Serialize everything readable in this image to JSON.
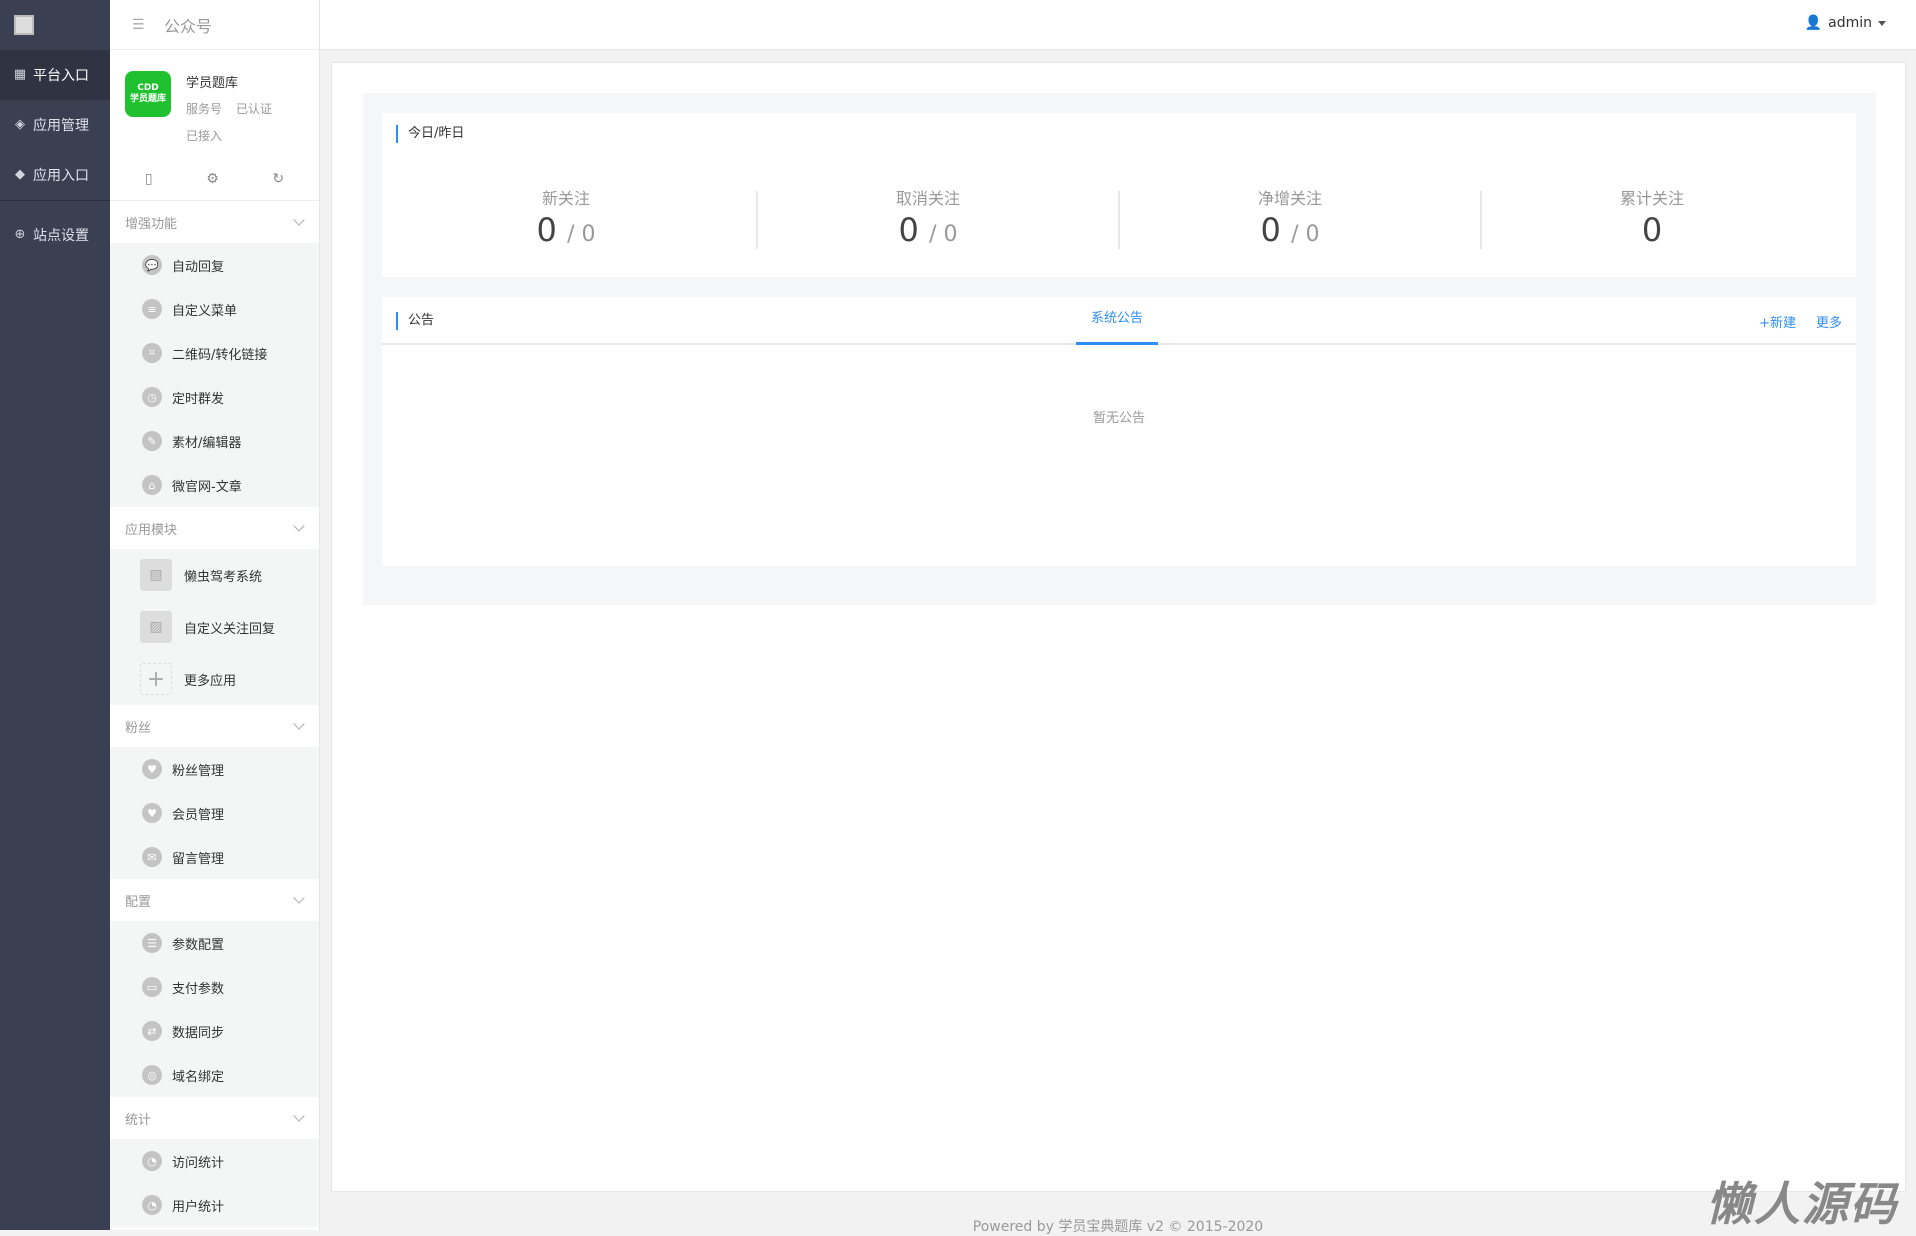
{
  "nav1": {
    "items": [
      {
        "label": "平台入口",
        "icon": "grid-icon",
        "active": true
      },
      {
        "label": "应用管理",
        "icon": "cubes-icon"
      },
      {
        "label": "应用入口",
        "icon": "cube-icon"
      }
    ],
    "settings": {
      "label": "站点设置",
      "icon": "globe-icon"
    }
  },
  "nav2": {
    "title": "公众号",
    "account": {
      "logo_text": "学员题库",
      "name": "学员题库",
      "type": "服务号",
      "verified": "已认证",
      "status": "已接入"
    },
    "groups": [
      {
        "title": "增强功能",
        "items": [
          "自动回复",
          "自定义菜单",
          "二维码/转化链接",
          "定时群发",
          "素材/编辑器",
          "微官网-文章"
        ]
      },
      {
        "title": "应用模块",
        "apps": [
          "懒虫驾考系统",
          "自定义关注回复"
        ],
        "more": "更多应用"
      },
      {
        "title": "粉丝",
        "items": [
          "粉丝管理",
          "会员管理",
          "留言管理"
        ]
      },
      {
        "title": "配置",
        "items": [
          "参数配置",
          "支付参数",
          "数据同步",
          "域名绑定"
        ]
      },
      {
        "title": "统计",
        "items": [
          "访问统计",
          "用户统计"
        ]
      }
    ]
  },
  "header": {
    "user": "admin"
  },
  "stats": {
    "title": "今日/昨日",
    "items": [
      {
        "label": "新关注",
        "today": "0",
        "yesterday": "/ 0"
      },
      {
        "label": "取消关注",
        "today": "0",
        "yesterday": "/ 0"
      },
      {
        "label": "净增关注",
        "today": "0",
        "yesterday": "/ 0"
      },
      {
        "label": "累计关注",
        "today": "0"
      }
    ]
  },
  "notice": {
    "title": "公告",
    "tab": "系统公告",
    "new": "+新建",
    "more": "更多",
    "empty": "暂无公告"
  },
  "footer": "Powered by 学员宝典题库 v2 © 2015-2020",
  "watermark": "懒人源码"
}
